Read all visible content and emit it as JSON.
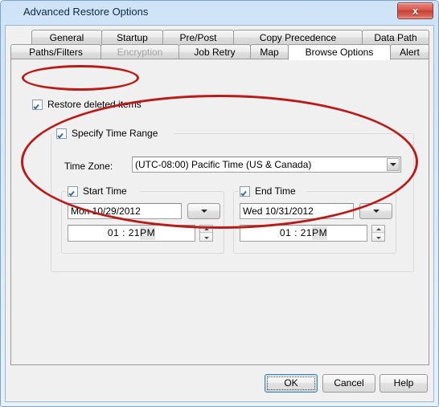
{
  "window": {
    "title": "Advanced Restore Options",
    "close_label": "x",
    "close_icon": "close-icon"
  },
  "tabs": {
    "row1": [
      {
        "label": "General",
        "selected": false,
        "disabled": false
      },
      {
        "label": "Startup",
        "selected": false,
        "disabled": false
      },
      {
        "label": "Pre/Post",
        "selected": false,
        "disabled": false
      },
      {
        "label": "Copy Precedence",
        "selected": false,
        "disabled": false
      },
      {
        "label": "Data Path",
        "selected": false,
        "disabled": false
      }
    ],
    "row2": [
      {
        "label": "Paths/Filters",
        "selected": false,
        "disabled": false
      },
      {
        "label": "Encryption",
        "selected": false,
        "disabled": true
      },
      {
        "label": "Job Retry",
        "selected": false,
        "disabled": false
      },
      {
        "label": "Map",
        "selected": false,
        "disabled": false
      },
      {
        "label": "Browse Options",
        "selected": true,
        "disabled": false
      },
      {
        "label": "Alert",
        "selected": false,
        "disabled": false
      }
    ]
  },
  "browse_options": {
    "restore_deleted_items": {
      "label": "Restore deleted items",
      "checked": true
    },
    "specify_time_range": {
      "label": "Specify Time Range",
      "checked": true
    },
    "time_zone": {
      "label": "Time Zone:",
      "value": "(UTC-08:00) Pacific Time (US & Canada)"
    },
    "start_time": {
      "group_label": "Start Time",
      "checked": true,
      "date": "Mon 10/29/2012",
      "time": "01 : 21",
      "ampm": "PM"
    },
    "end_time": {
      "group_label": "End Time",
      "checked": true,
      "date": "Wed 10/31/2012",
      "time": "01 : 21",
      "ampm": "PM"
    }
  },
  "footer": {
    "ok": "OK",
    "cancel": "Cancel",
    "help": "Help"
  },
  "annotations": {
    "color": "#b81c19",
    "shapes": [
      {
        "name": "restore-deleted-items-highlight"
      },
      {
        "name": "specify-time-range-highlight"
      }
    ]
  }
}
